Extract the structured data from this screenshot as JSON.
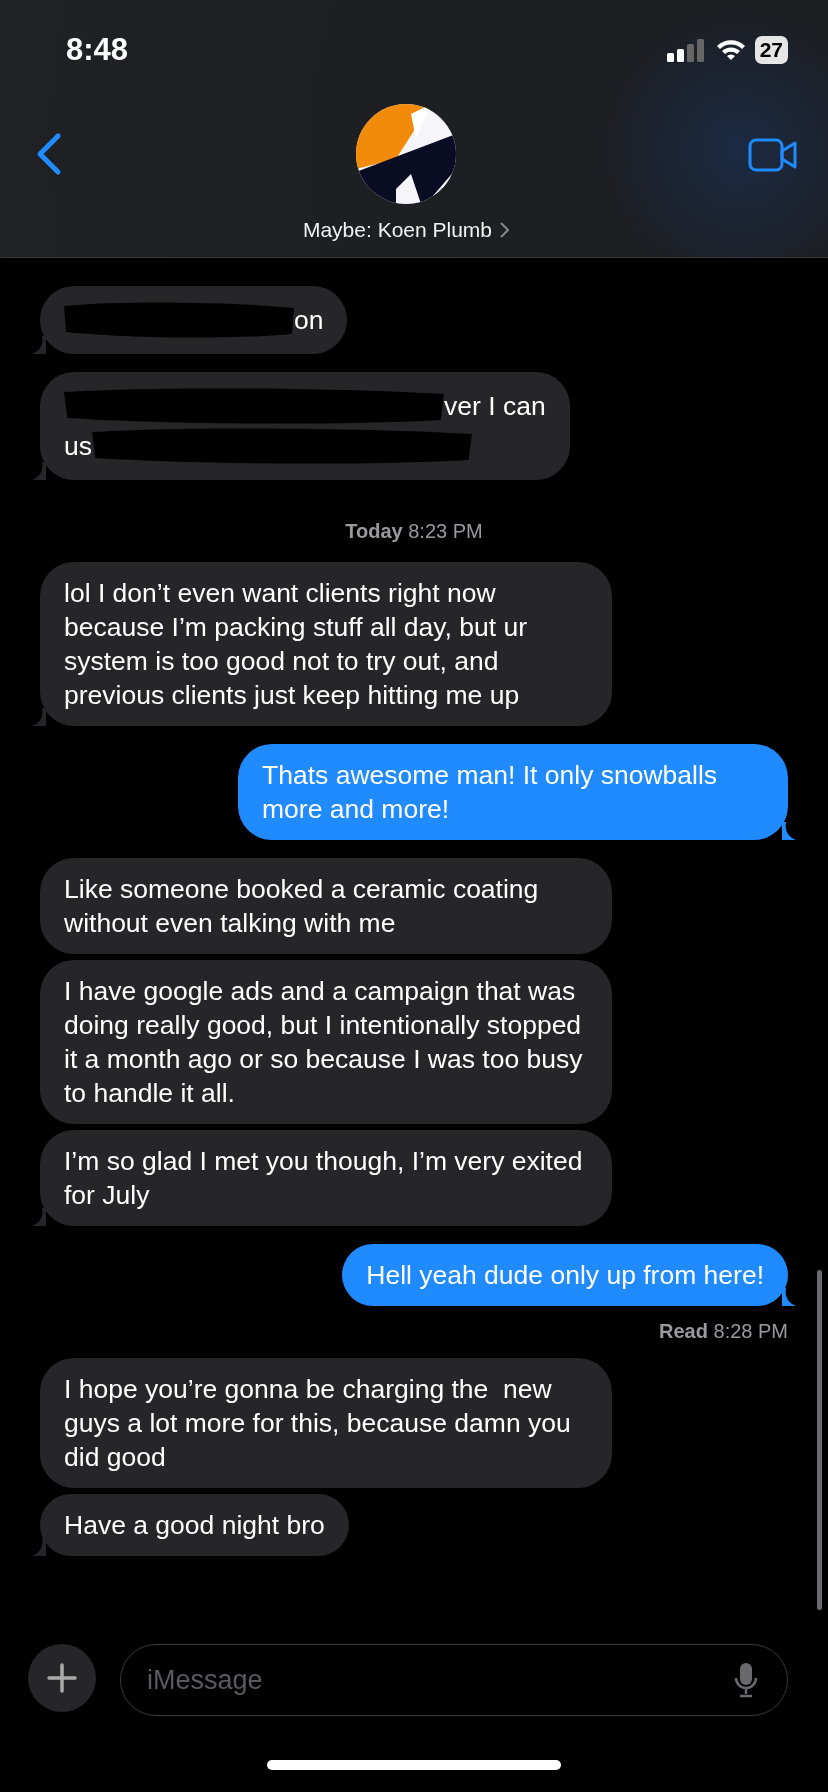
{
  "status_bar": {
    "time": "8:48",
    "battery": "27"
  },
  "header": {
    "contact_name": "Maybe: Koen Plumb"
  },
  "messages": [
    {
      "kind": "redacted",
      "outgoing": false,
      "tail": true,
      "lines": [
        [
          {
            "kind": "scribble"
          },
          {
            "kind": "text",
            "text": "on"
          }
        ]
      ]
    },
    {
      "kind": "redacted",
      "outgoing": false,
      "tail": true,
      "lines": [
        [
          {
            "kind": "scribble"
          },
          {
            "kind": "text",
            "text": "ver I can"
          }
        ],
        [
          {
            "kind": "text",
            "text": "us"
          },
          {
            "kind": "scribble"
          }
        ]
      ]
    },
    {
      "kind": "timestamp",
      "label": "Today",
      "time": "8:23 PM"
    },
    {
      "kind": "text",
      "outgoing": false,
      "tail": true,
      "text": "lol I don’t even want clients right now because I’m packing stuff all day, but ur system is too good not to try out, and previous clients just keep hitting me up"
    },
    {
      "kind": "text",
      "outgoing": true,
      "tail": true,
      "text": "Thats awesome man! It only snowballs more and more!"
    },
    {
      "kind": "text",
      "outgoing": false,
      "tail": false,
      "text": "Like someone booked a ceramic coating without even talking with me"
    },
    {
      "kind": "text",
      "outgoing": false,
      "tail": false,
      "text": "I have google ads and a campaign that was doing really good, but I intentionally stopped it a month ago or so because I was too busy to handle it all."
    },
    {
      "kind": "text",
      "outgoing": false,
      "tail": true,
      "text": "I’m so glad I met you though, I’m very exited for July"
    },
    {
      "kind": "text",
      "outgoing": true,
      "tail": true,
      "text": "Hell yeah dude only up from here!"
    },
    {
      "kind": "receipt",
      "label": "Read",
      "time": "8:28 PM"
    },
    {
      "kind": "text",
      "outgoing": false,
      "tail": false,
      "text": "I hope you’re gonna be charging the  new guys a lot more for this, because damn you did good"
    },
    {
      "kind": "text",
      "outgoing": false,
      "tail": true,
      "text": "Have a good night bro"
    }
  ],
  "composer": {
    "placeholder": "iMessage"
  }
}
